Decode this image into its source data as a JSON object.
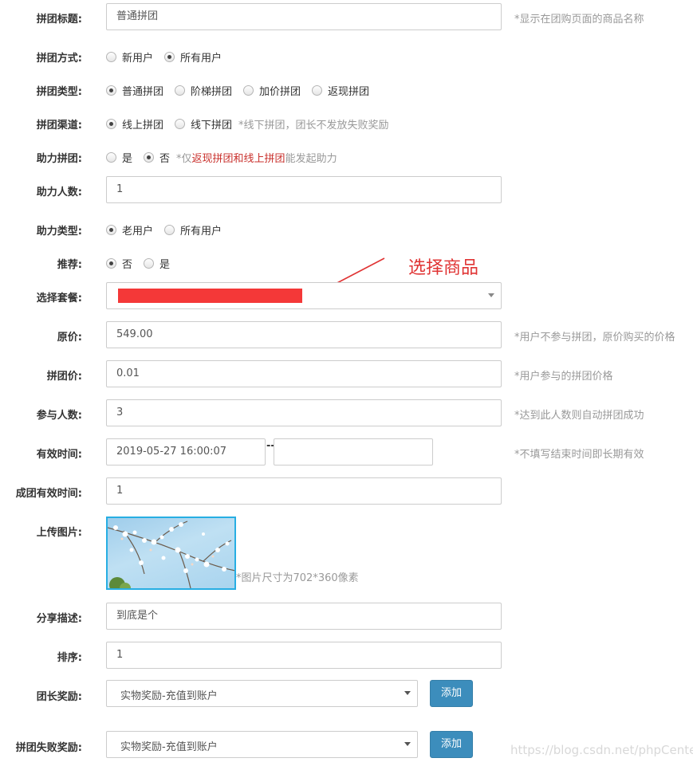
{
  "title": {
    "label": "拼团标题:",
    "value": "普通拼团",
    "hint": "*显示在团购页面的商品名称"
  },
  "mode": {
    "label": "拼团方式:",
    "options": [
      "新用户",
      "所有用户"
    ],
    "selected": "所有用户"
  },
  "type": {
    "label": "拼团类型:",
    "options": [
      "普通拼团",
      "阶梯拼团",
      "加价拼团",
      "返现拼团"
    ],
    "selected": "普通拼团"
  },
  "channel": {
    "label": "拼团渠道:",
    "options": [
      "线上拼团",
      "线下拼团"
    ],
    "selected": "线上拼团",
    "hint": "*线下拼团，团长不发放失败奖励"
  },
  "assist": {
    "label": "助力拼团:",
    "options": [
      "是",
      "否"
    ],
    "selected": "否",
    "hint_prefix": "*仅",
    "hint_red": "返现拼团和线上拼团",
    "hint_suffix": "能发起助力"
  },
  "assist_count": {
    "label": "助力人数:",
    "value": "1"
  },
  "assist_type": {
    "label": "助力类型:",
    "options": [
      "老用户",
      "所有用户"
    ],
    "selected": "老用户"
  },
  "recommend": {
    "label": "推荐:",
    "options": [
      "否",
      "是"
    ],
    "selected": "否"
  },
  "package": {
    "label": "选择套餐:",
    "annotation": "选择商品",
    "annotation_color": "#e03434"
  },
  "original_price": {
    "label": "原价:",
    "value": "549.00",
    "hint": "*用户不参与拼团，原价购买的价格"
  },
  "group_price": {
    "label": "拼团价:",
    "value": "0.01",
    "hint": "*用户参与的拼团价格"
  },
  "participants": {
    "label": "参与人数:",
    "value": "3",
    "hint": "*达到此人数则自动拼团成功"
  },
  "valid_time": {
    "label": "有效时间:",
    "start": "2019-05-27 16:00:07",
    "separator": "--",
    "end": "",
    "hint": "*不填写结束时间即长期有效"
  },
  "group_valid_time": {
    "label": "成团有效时间:",
    "value": "1"
  },
  "upload": {
    "label": "上传图片:",
    "hint": "*图片尺寸为702*360像素"
  },
  "share_desc": {
    "label": "分享描述:",
    "value": "到底是个"
  },
  "sort": {
    "label": "排序:",
    "value": "1"
  },
  "leader_reward": {
    "label": "团长奖励:",
    "selected": "实物奖励-充值到账户",
    "button": "添加"
  },
  "fail_reward": {
    "label": "拼团失败奖励:",
    "selected": "实物奖励-充值到账户",
    "button": "添加"
  },
  "watermark": "https://blog.csdn.net/phpCenter",
  "colors": {
    "primary_button": "#3c8dbc",
    "redaction": "#f43838",
    "highlight_text": "#c9302c"
  }
}
